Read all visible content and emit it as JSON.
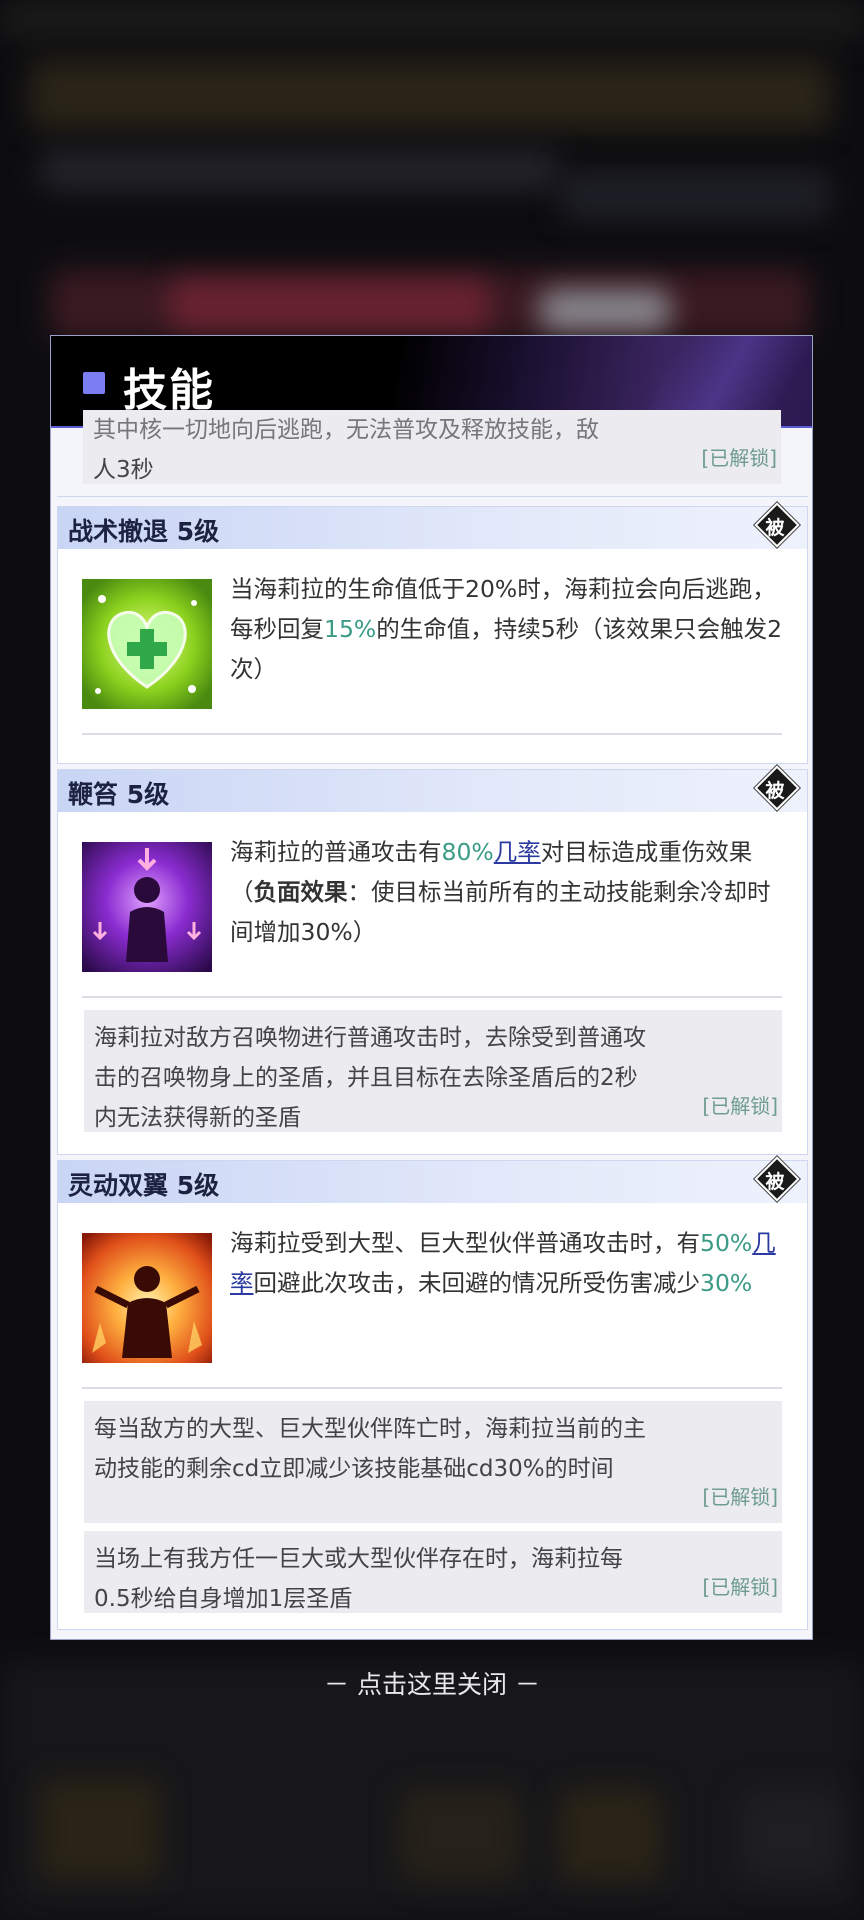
{
  "header": {
    "title": "技能"
  },
  "top_note": {
    "text_clip": "其中核一切地向后逃跑，无法普攻及释放技能，敌",
    "text_line2": "人3秒",
    "unlock": "[已解锁]"
  },
  "skills": [
    {
      "title": "战术撤退 5级",
      "badge": "被",
      "icon": "green-heart-icon",
      "desc": {
        "p1": "当海莉拉的生命值低于20%时，海莉拉会向后逃跑，每秒回复",
        "g1": "15%",
        "p2": "的生命值，持续5秒（该效果只会触发2次）"
      }
    },
    {
      "title": "鞭笞 5级",
      "badge": "被",
      "icon": "purple-figure-icon",
      "desc": {
        "p1": "海莉拉的普通攻击有",
        "g1": "80%",
        "link": "几率",
        "p2": "对目标造成重伤效果（",
        "bold": "负面效果",
        "p3": "：使目标当前所有的主动技能剩余冷却时间增加30%）"
      },
      "notes": [
        {
          "text": "海莉拉对敌方召唤物进行普通攻击时，去除受到普通攻击的召唤物身上的圣盾，并且目标在去除圣盾后的2秒内无法获得新的圣盾",
          "unlock": "[已解锁]"
        }
      ]
    },
    {
      "title": "灵动双翼 5级",
      "badge": "被",
      "icon": "fire-figure-icon",
      "desc": {
        "p1": "海莉拉受到大型、巨大型伙伴普通攻击时，有",
        "g1": "50%",
        "link": "几率",
        "p2": "回避此次攻击，未回避的情况所受伤害减少",
        "g2": "30%"
      },
      "notes": [
        {
          "text": "每当敌方的大型、巨大型伙伴阵亡时，海莉拉当前的主动技能的剩余cd立即减少该技能基础cd30%的时间",
          "unlock": "[已解锁]"
        },
        {
          "text": "当场上有我方任一巨大或大型伙伴存在时，海莉拉每0.5秒给自身增加1层圣盾",
          "unlock": "[已解锁]"
        }
      ]
    }
  ],
  "close_text": "－ 点击这里关闭 －"
}
